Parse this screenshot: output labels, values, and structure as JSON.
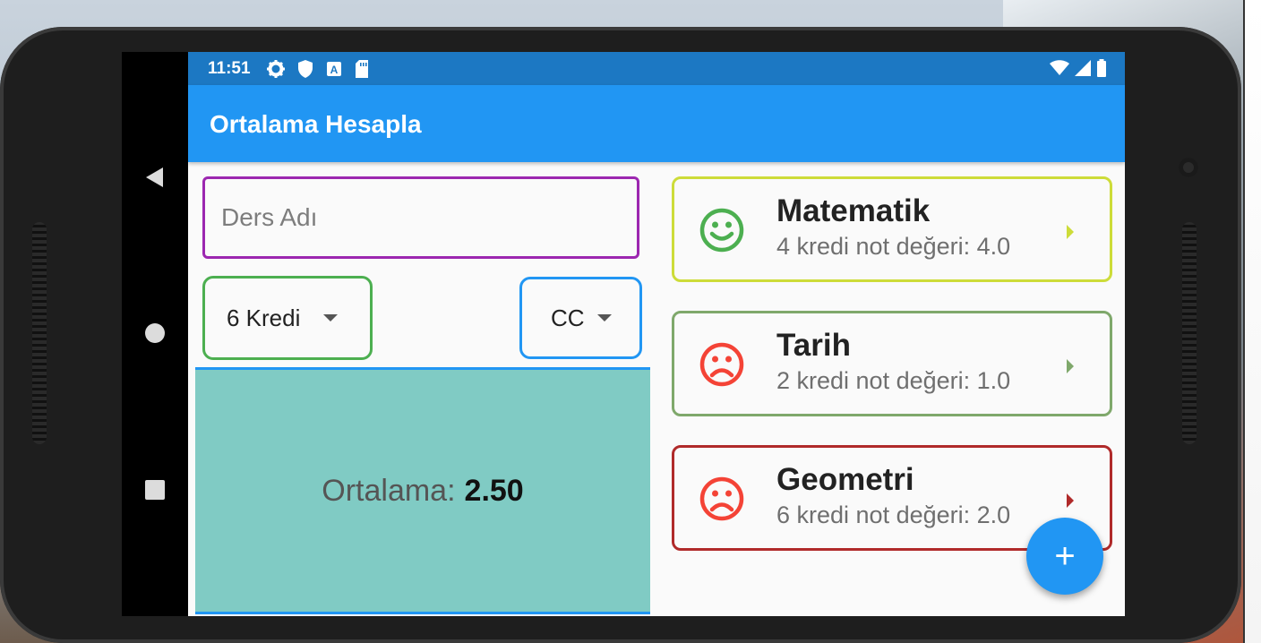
{
  "status_bar": {
    "time": "11:51",
    "left_icons": [
      "gear-icon",
      "shield-icon",
      "a-box-icon",
      "sd-card-icon"
    ],
    "right_icons": [
      "wifi-icon",
      "signal-icon",
      "battery-icon"
    ]
  },
  "app_bar": {
    "title": "Ortalama Hesapla"
  },
  "form": {
    "lesson_name_placeholder": "Ders Adı",
    "lesson_name_value": "",
    "credit_dropdown_value": "6 Kredi",
    "grade_dropdown_value": "CC"
  },
  "result": {
    "label": "Ortalama:",
    "value": "2.50",
    "bg_color": "#80cbc4"
  },
  "lessons": [
    {
      "name": "Matematik",
      "detail": "4 kredi not değeri: 4.0",
      "mood": "smile-icon",
      "border_color": "#cddc39",
      "face_color": "#4caf50",
      "arrow_color": "#cddc39"
    },
    {
      "name": "Tarih",
      "detail": "2 kredi not değeri: 1.0",
      "mood": "frown-icon",
      "border_color": "#7fa86b",
      "face_color": "#f44336",
      "arrow_color": "#7fa86b"
    },
    {
      "name": "Geometri",
      "detail": "6 kredi not değeri: 2.0",
      "mood": "frown-icon",
      "border_color": "#b02a2a",
      "face_color": "#f44336",
      "arrow_color": "#b02a2a"
    }
  ],
  "fab": {
    "label": "+"
  },
  "colors": {
    "primary": "#2196f3",
    "status_bar": "#1c78c3",
    "input_border": "#9c27b0",
    "credit_border": "#4caf50"
  }
}
